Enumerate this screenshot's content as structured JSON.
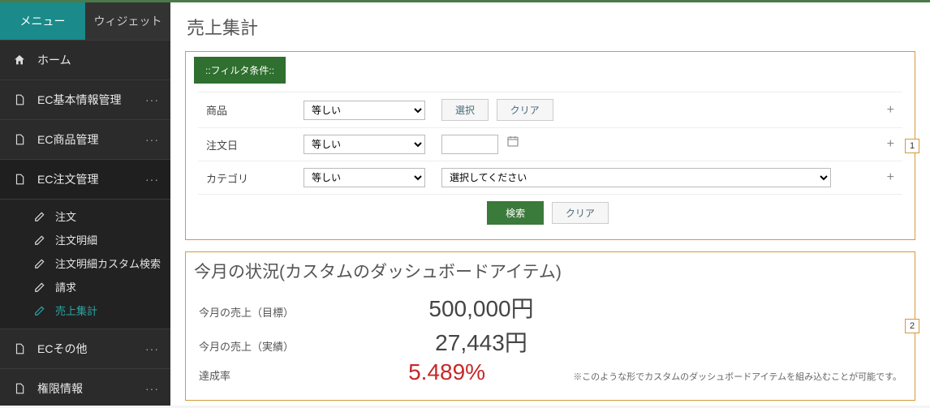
{
  "sidebar": {
    "tabs": {
      "menu": "メニュー",
      "widget": "ウィジェット"
    },
    "items": [
      {
        "label": "ホーム",
        "icon": "home"
      },
      {
        "label": "EC基本情報管理",
        "icon": "doc",
        "dots": true
      },
      {
        "label": "EC商品管理",
        "icon": "doc",
        "dots": true
      },
      {
        "label": "EC注文管理",
        "icon": "doc",
        "dots": true,
        "expanded": true,
        "children": [
          {
            "label": "注文"
          },
          {
            "label": "注文明細"
          },
          {
            "label": "注文明細カスタム検索"
          },
          {
            "label": "請求"
          },
          {
            "label": "売上集計",
            "active": true
          }
        ]
      },
      {
        "label": "ECその他",
        "icon": "doc",
        "dots": true
      },
      {
        "label": "権限情報",
        "icon": "doc",
        "dots": true
      }
    ]
  },
  "page": {
    "title": "売上集計"
  },
  "filter": {
    "heading": "::フィルタ条件::",
    "rows": [
      {
        "label": "商品",
        "op": "等しい",
        "buttons": [
          "選択",
          "クリア"
        ]
      },
      {
        "label": "注文日",
        "op": "等しい",
        "date": true
      },
      {
        "label": "カテゴリ",
        "op": "等しい",
        "category_placeholder": "選択してください"
      }
    ],
    "search": "検索",
    "clear": "クリア",
    "plus": "+"
  },
  "panels": {
    "badge1": "1",
    "badge2": "2"
  },
  "dashboard": {
    "title": "今月の状況(カスタムのダッシュボードアイテム)",
    "rows": [
      {
        "label": "今月の売上（目標）",
        "value": "500,000円"
      },
      {
        "label": "今月の売上（実績）",
        "value": "27,443円"
      },
      {
        "label": "達成率",
        "value": "5.489%",
        "red": true
      }
    ],
    "note": "※このような形でカスタムのダッシュボードアイテムを組み込むことが可能です。"
  }
}
